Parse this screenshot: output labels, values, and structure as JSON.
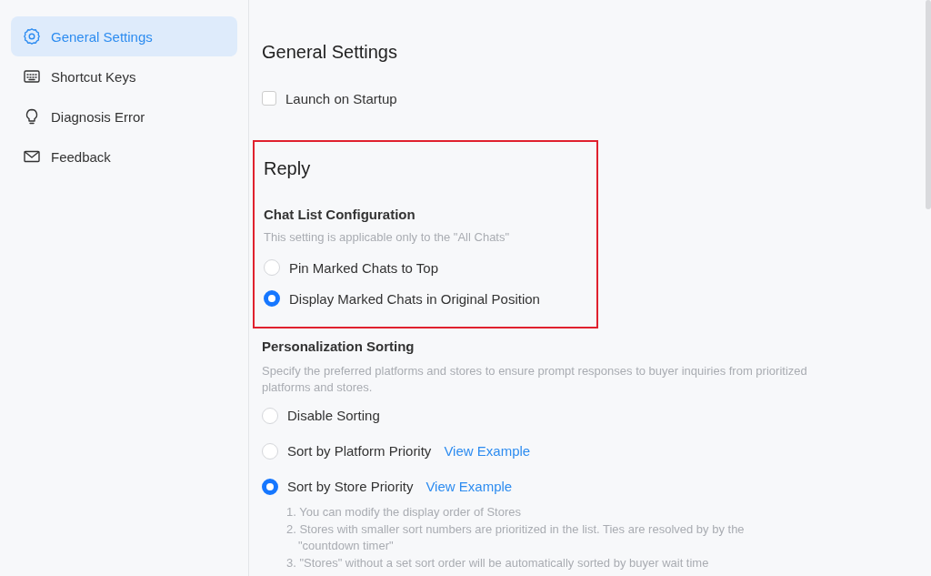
{
  "sidebar": {
    "items": [
      {
        "label": "General Settings",
        "kind": "gear",
        "selected": true
      },
      {
        "label": "Shortcut Keys",
        "kind": "keyboard",
        "selected": false
      },
      {
        "label": "Diagnosis Error",
        "kind": "bulb",
        "selected": false
      },
      {
        "label": "Feedback",
        "kind": "mail",
        "selected": false
      }
    ]
  },
  "page_title": "General Settings",
  "launch_on_startup": {
    "label": "Launch on Startup",
    "checked": false
  },
  "reply": {
    "title": "Reply",
    "highlighted": true,
    "chat_list": {
      "title": "Chat List Configuration",
      "hint": "This setting is applicable only to the \"All Chats\"",
      "options": [
        {
          "label": "Pin Marked Chats to Top",
          "selected": false
        },
        {
          "label": "Display Marked Chats in Original Position",
          "selected": true
        }
      ]
    }
  },
  "personalization": {
    "title": "Personalization Sorting",
    "description": "Specify the preferred platforms and stores to ensure prompt responses to buyer inquiries from prioritized platforms and stores.",
    "options": [
      {
        "label": "Disable Sorting",
        "selected": false
      },
      {
        "label": "Sort by Platform Priority",
        "selected": false,
        "link": "View Example"
      },
      {
        "label": "Sort by Store Priority",
        "selected": true,
        "link": "View Example",
        "notes": [
          "1. You can modify the display order of Stores",
          "2. Stores with smaller sort numbers are prioritized in the list. Ties are resolved by by the \"countdown timer\"",
          "3. \"Stores\" without a set sort order will be automatically sorted by buyer wait time"
        ]
      }
    ]
  }
}
